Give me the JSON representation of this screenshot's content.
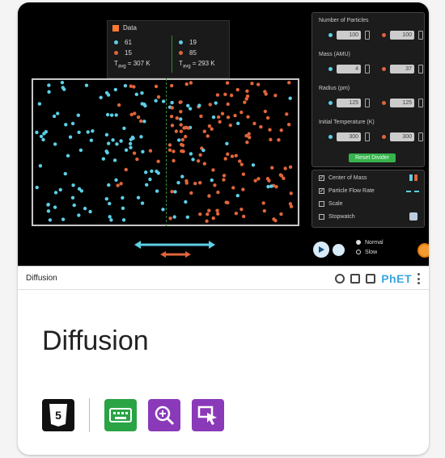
{
  "sim": {
    "legend": {
      "label": "Data",
      "left_blue": "61",
      "left_orange": "15",
      "left_temp": "T",
      "left_temp_sub": "avg",
      "left_temp_val": " = 307 K",
      "right_blue": "19",
      "right_orange": "85",
      "right_temp": "T",
      "right_temp_sub": "avg",
      "right_temp_val": " = 293 K"
    },
    "panel": {
      "num_particles_label": "Number of Particles",
      "num_left": "100",
      "num_right": "100",
      "mass_label": "Mass (AMU)",
      "mass_left": "4",
      "mass_right": "37",
      "radius_label": "Radius (pm)",
      "radius_left": "125",
      "radius_right": "125",
      "temp_label": "Initial Temperature (K)",
      "temp_left": "300",
      "temp_right": "300",
      "reset_label": "Reset Divider"
    },
    "options": {
      "center_of_mass": "Center of Mass",
      "flow_rate": "Particle Flow Rate",
      "scale": "Scale",
      "stopwatch": "Stopwatch"
    },
    "speed": {
      "normal": "Normal",
      "slow": "Slow"
    }
  },
  "bar": {
    "sim_name": "Diffusion",
    "brand": "PhET"
  },
  "card": {
    "title": "Diffusion"
  },
  "colors": {
    "blue_particle": "#5ccfe6",
    "orange_particle": "#e0653a",
    "keyboard_badge": "#2aa345",
    "purple_badge": "#8a3ab9"
  }
}
